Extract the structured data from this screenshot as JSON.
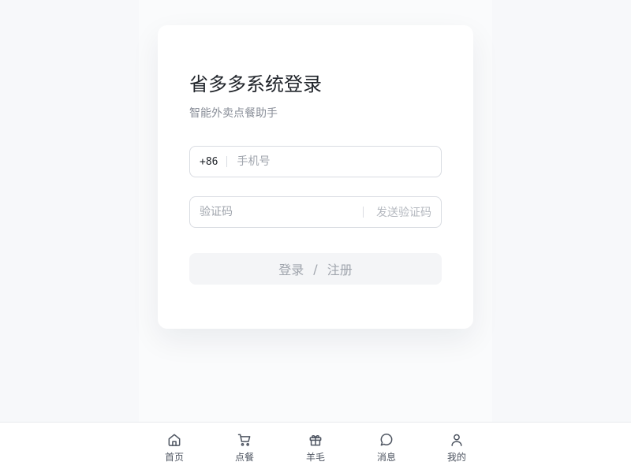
{
  "login": {
    "title": "省多多系统登录",
    "subtitle": "智能外卖点餐助手",
    "country_code": "+86",
    "phone_placeholder": "手机号",
    "phone_value": "",
    "code_placeholder": "验证码",
    "code_value": "",
    "send_code_label": "发送验证码",
    "submit_login_label": "登录",
    "submit_separator": "/",
    "submit_register_label": "注册"
  },
  "tabbar": {
    "items": [
      {
        "label": "首页",
        "icon": "home-icon"
      },
      {
        "label": "点餐",
        "icon": "cart-icon"
      },
      {
        "label": "羊毛",
        "icon": "gift-icon"
      },
      {
        "label": "消息",
        "icon": "message-icon"
      },
      {
        "label": "我的",
        "icon": "user-icon"
      }
    ]
  },
  "colors": {
    "page_background": "#f7f8fa",
    "card_background": "#ffffff",
    "text_primary": "#1f2329",
    "text_secondary": "#8a8f99",
    "disabled_text": "#a0a5ad",
    "disabled_button": "#f4f5f7",
    "border": "#d9dce2"
  }
}
